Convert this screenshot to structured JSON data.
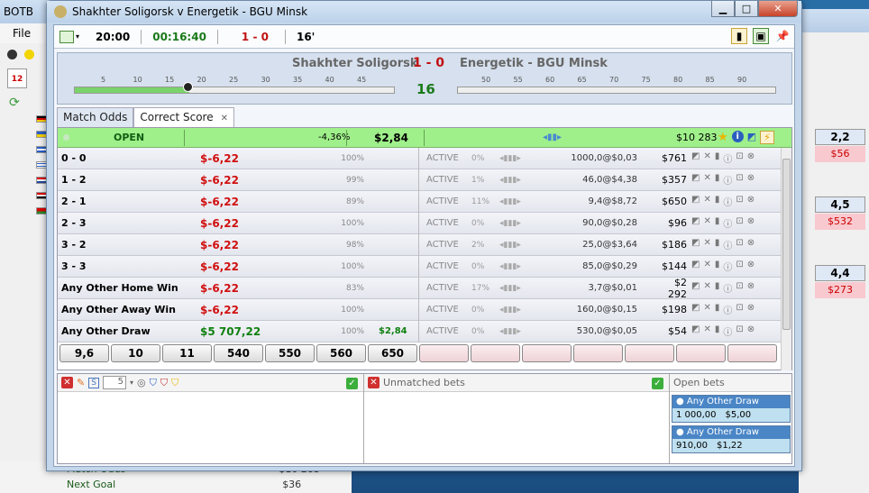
{
  "bg_app": {
    "title_partial": "BOTB",
    "menu_file": "File",
    "date_icon": "12"
  },
  "bg_bottom": {
    "row1": "Match Odds",
    "row1_value": "$10 283",
    "row2": "Next Goal",
    "row2_value": "$36"
  },
  "bg_right": {
    "odds": [
      "2,2",
      "4,5",
      "4,4"
    ],
    "pl": [
      "$56",
      "$532",
      "$273"
    ]
  },
  "window": {
    "title": "Shakhter Soligorsk v Energetik - BGU Minsk"
  },
  "toolbar": {
    "kickoff": "20:00",
    "elapsed": "00:16:40",
    "score": "1 - 0",
    "minute": "16'"
  },
  "score_header": {
    "home": "Shakhter Soligorsk",
    "score": "1 - 0",
    "away": "Energetik - BGU Minsk",
    "minute": "16",
    "timeline_first_half": [
      "5",
      "10",
      "15",
      "20",
      "25",
      "30",
      "35",
      "40",
      "45"
    ],
    "timeline_second_half": [
      "50",
      "55",
      "60",
      "65",
      "70",
      "75",
      "80",
      "85",
      "90"
    ],
    "elapsed_fraction": 0.36
  },
  "tabs": [
    {
      "label": "Match Odds"
    },
    {
      "label": "Correct Score"
    }
  ],
  "market": {
    "status": "OPEN",
    "overround": "-4,36%",
    "stake_total": "$2,84",
    "bank": "$10 283",
    "rows": [
      {
        "name": "0 - 0",
        "pl": "$-6,22",
        "pct": "100%",
        "price": "",
        "state": "ACTIVE",
        "share": "0%",
        "back": "1000,0@$0,03",
        "exposure": "$761"
      },
      {
        "name": "1 - 2",
        "pl": "$-6,22",
        "pct": "99%",
        "price": "",
        "state": "ACTIVE",
        "share": "1%",
        "back": "46,0@$4,38",
        "exposure": "$357"
      },
      {
        "name": "2 - 1",
        "pl": "$-6,22",
        "pct": "89%",
        "price": "",
        "state": "ACTIVE",
        "share": "11%",
        "back": "9,4@$8,72",
        "exposure": "$650"
      },
      {
        "name": "2 - 3",
        "pl": "$-6,22",
        "pct": "100%",
        "price": "",
        "state": "ACTIVE",
        "share": "0%",
        "back": "90,0@$0,28",
        "exposure": "$96"
      },
      {
        "name": "3 - 2",
        "pl": "$-6,22",
        "pct": "98%",
        "price": "",
        "state": "ACTIVE",
        "share": "2%",
        "back": "25,0@$3,64",
        "exposure": "$186"
      },
      {
        "name": "3 - 3",
        "pl": "$-6,22",
        "pct": "100%",
        "price": "",
        "state": "ACTIVE",
        "share": "0%",
        "back": "85,0@$0,29",
        "exposure": "$144"
      },
      {
        "name": "Any Other Home Win",
        "pl": "$-6,22",
        "pct": "83%",
        "price": "",
        "state": "ACTIVE",
        "share": "17%",
        "back": "3,7@$0,01",
        "exposure": "$2 292"
      },
      {
        "name": "Any Other Away Win",
        "pl": "$-6,22",
        "pct": "100%",
        "price": "",
        "state": "ACTIVE",
        "share": "0%",
        "back": "160,0@$0,15",
        "exposure": "$198"
      },
      {
        "name": "Any Other Draw",
        "pl": "$5 707,22",
        "pct": "100%",
        "price": "$2,84",
        "state": "ACTIVE",
        "share": "0%",
        "back": "530,0@$0,05",
        "exposure": "$54"
      }
    ],
    "quick_odds": [
      "9,6",
      "10",
      "11",
      "540",
      "550",
      "560",
      "650"
    ]
  },
  "panels": {
    "stake_value": "5",
    "unmatched_label": "Unmatched bets",
    "open_label": "Open bets",
    "open_bets": [
      {
        "selection": "Any Other Draw",
        "odds": "1 000,00",
        "stake": "$5,00"
      },
      {
        "selection": "Any Other Draw",
        "odds": "910,00",
        "stake": "$1,22"
      }
    ]
  }
}
